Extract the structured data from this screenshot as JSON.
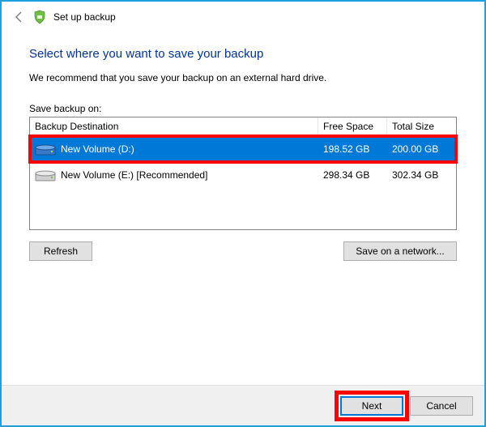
{
  "titlebar": {
    "title": "Set up backup"
  },
  "main": {
    "heading": "Select where you want to save your backup",
    "recommend": "We recommend that you save your backup on an external hard drive.",
    "listLabel": "Save backup on:",
    "columns": {
      "dest": "Backup Destination",
      "free": "Free Space",
      "total": "Total Size"
    },
    "rows": [
      {
        "name": "New Volume (D:)",
        "free": "198.52 GB",
        "total": "200.00 GB",
        "selected": true
      },
      {
        "name": "New Volume (E:) [Recommended]",
        "free": "298.34 GB",
        "total": "302.34 GB",
        "selected": false
      }
    ],
    "refresh": "Refresh",
    "saveNetwork": "Save on a network..."
  },
  "footer": {
    "next": "Next",
    "cancel": "Cancel"
  }
}
